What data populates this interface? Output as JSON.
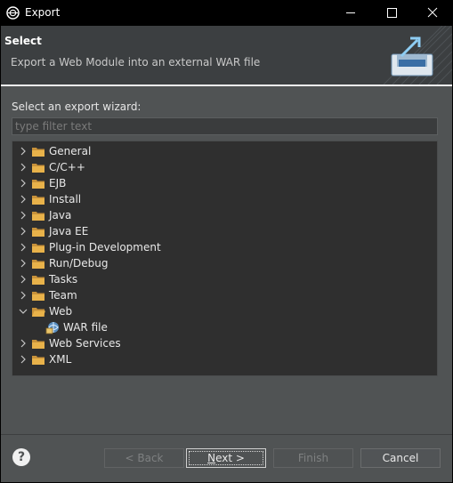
{
  "window": {
    "title": "Export"
  },
  "header": {
    "title": "Select",
    "description": "Export a Web Module into an external WAR file"
  },
  "wizard": {
    "label": "Select an export wizard:",
    "filter_placeholder": "type filter text"
  },
  "tree": [
    {
      "label": "General",
      "expanded": false
    },
    {
      "label": "C/C++",
      "expanded": false
    },
    {
      "label": "EJB",
      "expanded": false
    },
    {
      "label": "Install",
      "expanded": false
    },
    {
      "label": "Java",
      "expanded": false
    },
    {
      "label": "Java EE",
      "expanded": false
    },
    {
      "label": "Plug-in Development",
      "expanded": false
    },
    {
      "label": "Run/Debug",
      "expanded": false
    },
    {
      "label": "Tasks",
      "expanded": false
    },
    {
      "label": "Team",
      "expanded": false
    },
    {
      "label": "Web",
      "expanded": true,
      "children": [
        {
          "label": "WAR file"
        }
      ]
    },
    {
      "label": "Web Services",
      "expanded": false
    },
    {
      "label": "XML",
      "expanded": false
    }
  ],
  "buttons": {
    "back": "< Back",
    "next_mnemonic": "N",
    "next_rest": "ext >",
    "finish": "Finish",
    "cancel": "Cancel",
    "help": "?"
  },
  "colors": {
    "folder": "#e8b24a",
    "folder_dark": "#c8923a",
    "accent": "#3e95d8"
  },
  "icons": {
    "app": "eclipse-icon",
    "minimize": "minimize-icon",
    "maximize": "maximize-icon",
    "close": "close-icon",
    "banner": "export-wizard-icon",
    "folder": "folder-icon",
    "expand": "chevron-right-icon",
    "collapse": "chevron-down-icon",
    "war": "war-file-icon",
    "help": "help-icon"
  }
}
